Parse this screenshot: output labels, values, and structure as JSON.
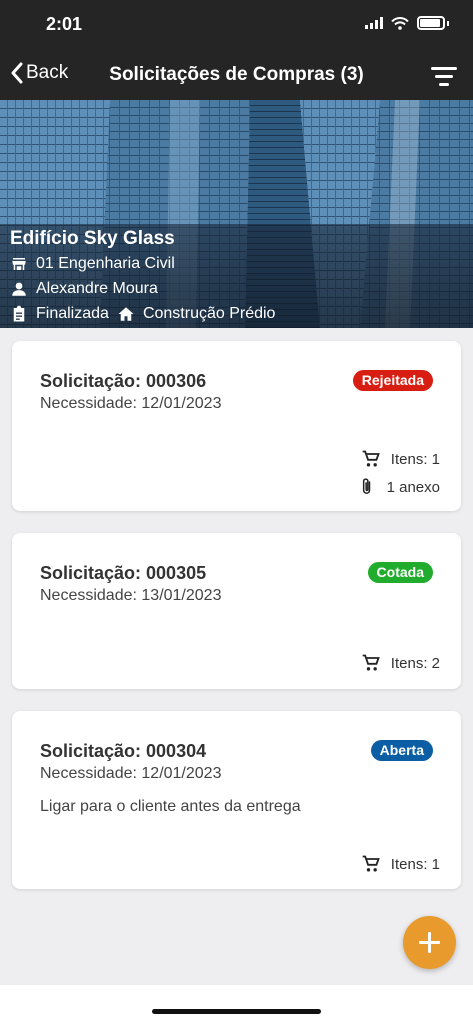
{
  "status_bar": {
    "time": "2:01"
  },
  "nav": {
    "back_label": "Back",
    "title": "Solicitações de Compras (3)"
  },
  "project": {
    "name": "Edifício Sky Glass",
    "department": "01 Engenharia Civil",
    "responsible": "Alexandre Moura",
    "status": "Finalizada",
    "type": "Construção Prédio"
  },
  "requests": [
    {
      "title": "Solicitação: 000306",
      "need_date": "Necessidade: 12/01/2023",
      "badge": "Rejeitada",
      "badge_color": "#d81e13",
      "note": "",
      "items": "Itens: 1",
      "attachments": "1 anexo"
    },
    {
      "title": "Solicitação: 000305",
      "need_date": "Necessidade: 13/01/2023",
      "badge": "Cotada",
      "badge_color": "#22ac2d",
      "note": "",
      "items": "Itens: 2",
      "attachments": ""
    },
    {
      "title": "Solicitação: 000304",
      "need_date": "Necessidade: 12/01/2023",
      "badge": "Aberta",
      "badge_color": "#0b5ea4",
      "note": "Ligar para o cliente antes da entrega",
      "items": "Itens: 1",
      "attachments": ""
    }
  ],
  "colors": {
    "topbar": "#252526",
    "fab": "#e89a2c"
  },
  "icons": [
    "chevron-left-icon",
    "filter-icon",
    "store-icon",
    "person-icon",
    "clipboard-icon",
    "home-icon",
    "cart-icon",
    "paperclip-icon",
    "plus-icon"
  ]
}
